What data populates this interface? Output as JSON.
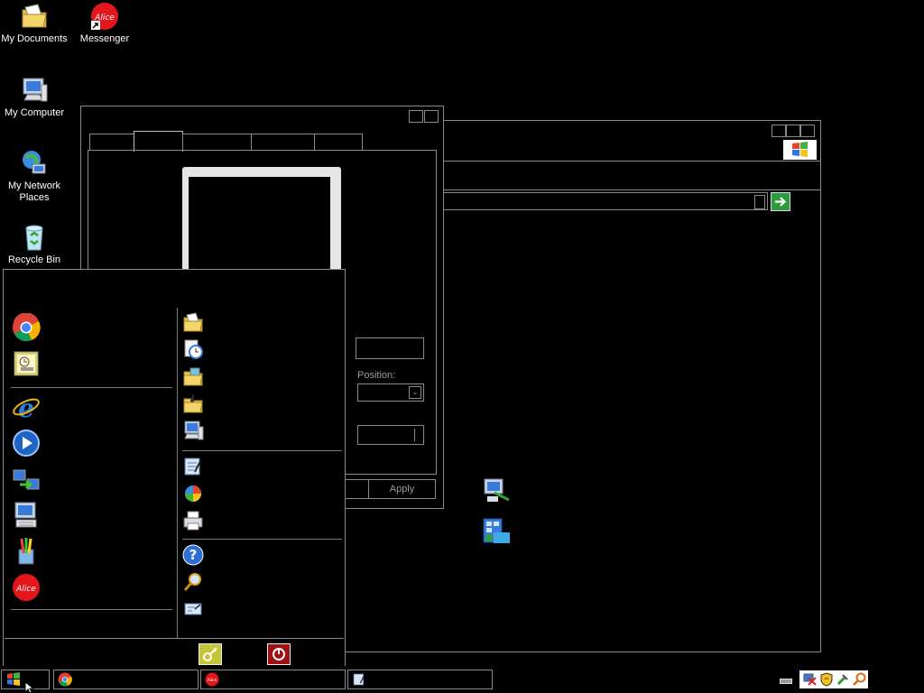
{
  "desktop": {
    "icons": [
      {
        "label": "My Documents",
        "icon": "my-documents-icon"
      },
      {
        "label": "Messenger",
        "icon": "alice-messenger-icon"
      },
      {
        "label": "My Computer",
        "icon": "my-computer-icon"
      },
      {
        "label": "My Network Places",
        "icon": "network-places-icon"
      },
      {
        "label": "Recycle Bin",
        "icon": "recycle-bin-icon"
      }
    ]
  },
  "properties_window": {
    "position_label": "Position:",
    "apply_label": "Apply"
  },
  "explorer_window": {
    "address_value": ""
  },
  "start_menu": {
    "pinned_icons": [
      "chrome-icon",
      "scheduled-tasks-icon"
    ],
    "recent_icons": [
      "internet-explorer-icon",
      "media-player-icon",
      "transfer-wizard-icon",
      "on-screen-keyboard-icon",
      "paint-icon",
      "alice-messenger-icon"
    ],
    "right_icons": [
      "my-documents-icon",
      "recent-documents-icon",
      "my-pictures-icon",
      "my-music-icon",
      "my-computer-icon",
      "control-panel-icon",
      "set-program-access-icon",
      "printers-icon",
      "help-icon",
      "search-icon",
      "run-icon"
    ],
    "footer_icons": [
      "log-off-icon",
      "turn-off-icon"
    ]
  },
  "taskbar": {
    "start_icon": "windows-logo-icon",
    "tasks": [
      "chrome-icon",
      "alice-messenger-icon",
      "control-panel-icon"
    ],
    "tray_icons": [
      "keyboard-icon",
      "network-icon",
      "security-shield-icon",
      "safely-remove-icon",
      "search-icon"
    ]
  }
}
